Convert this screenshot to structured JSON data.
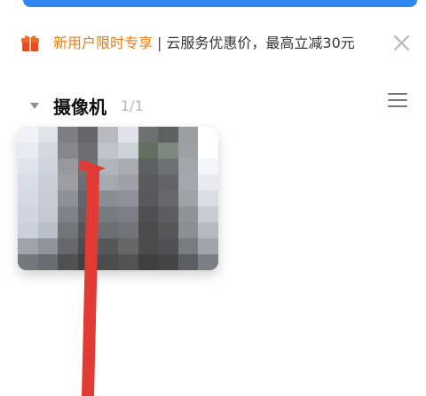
{
  "promo": {
    "highlight": "新用户限时专享",
    "separator": "|",
    "rest": "云服务优惠价，最高立减30元",
    "icon": "gift-icon",
    "close_icon": "close-icon"
  },
  "camera_section": {
    "title": "摄像机",
    "count": "1/1",
    "chevron_icon": "chevron-down-icon",
    "menu_icon": "menu-icon"
  },
  "colors": {
    "accent": "#2f86ee",
    "promo_orange": "#ef7d16",
    "arrow_red": "#e23b35"
  }
}
